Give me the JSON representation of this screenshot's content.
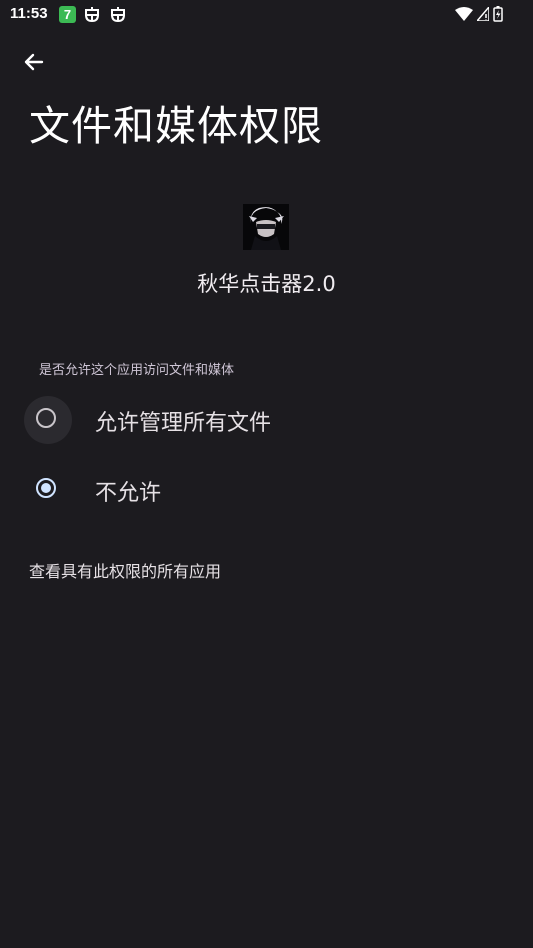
{
  "status_bar": {
    "time": "11:53",
    "notification_app_badge": "7"
  },
  "page": {
    "title": "文件和媒体权限"
  },
  "app": {
    "name": "秋华点击器2.0"
  },
  "permission": {
    "question": "是否允许这个应用访问文件和媒体",
    "options": [
      {
        "label": "允许管理所有文件",
        "selected": false
      },
      {
        "label": "不允许",
        "selected": true
      }
    ]
  },
  "footer": {
    "link": "查看具有此权限的所有应用"
  }
}
